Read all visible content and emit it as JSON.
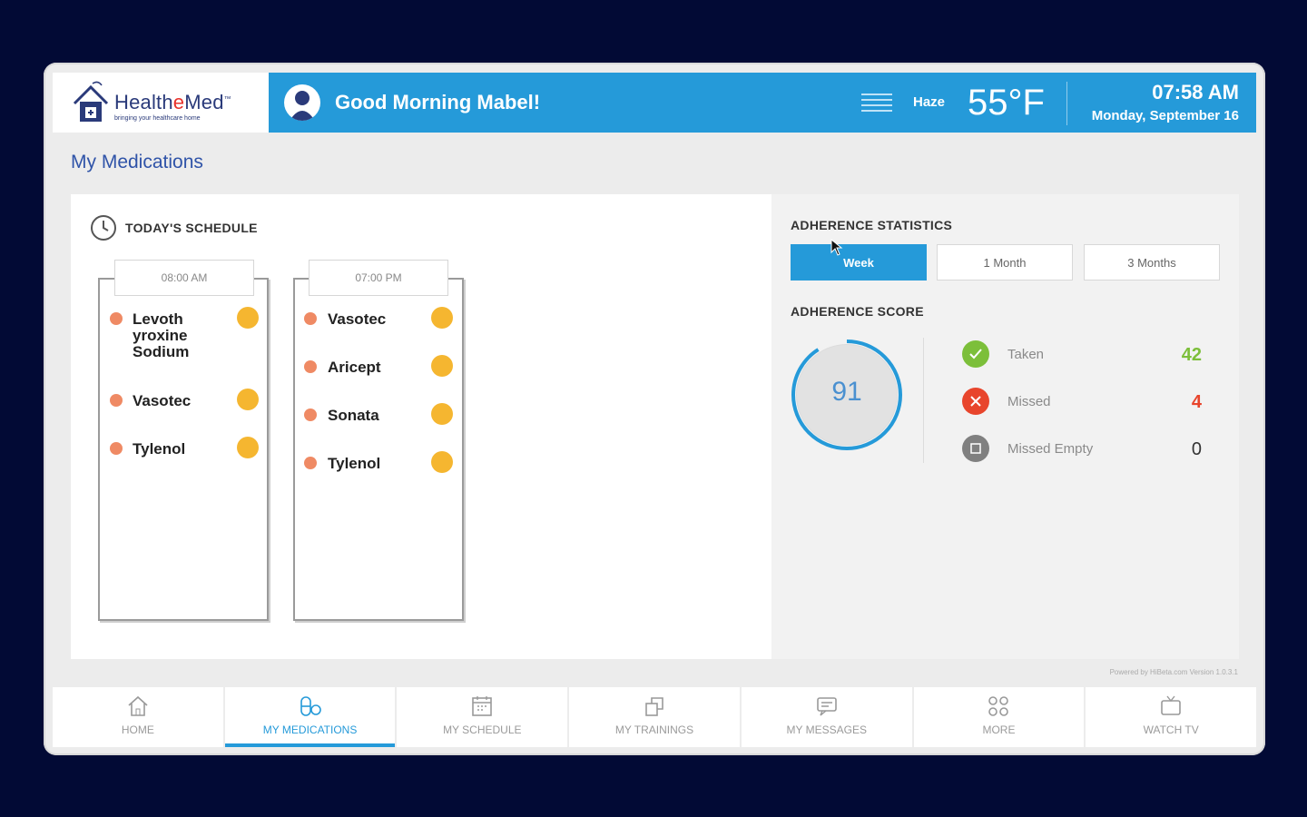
{
  "brand": {
    "name_prefix": "Health",
    "name_e": "e",
    "name_suffix": "Med",
    "tm": "™",
    "tagline": "bringing your healthcare home"
  },
  "header": {
    "greeting": "Good Morning Mabel!",
    "weather_condition": "Haze",
    "temperature": "55°F",
    "time": "07:58 AM",
    "date": "Monday, September 16"
  },
  "page_title": "My Medications",
  "schedule": {
    "title": "TODAY'S SCHEDULE",
    "slots": [
      {
        "time": "08:00 AM",
        "meds": [
          {
            "name": "Levoth yroxine Sodium"
          },
          {
            "name": "Vasotec"
          },
          {
            "name": "Tylenol"
          }
        ]
      },
      {
        "time": "07:00 PM",
        "meds": [
          {
            "name": "Vasotec"
          },
          {
            "name": "Aricept"
          },
          {
            "name": "Sonata"
          },
          {
            "name": "Tylenol"
          }
        ]
      }
    ]
  },
  "adherence": {
    "stats_title": "ADHERENCE STATISTICS",
    "tabs": [
      "Week",
      "1 Month",
      "3 Months"
    ],
    "active_tab": "Week",
    "score_title": "ADHERENCE SCORE",
    "score": "91",
    "stats": [
      {
        "label": "Taken",
        "value": "42",
        "color": "#7cbf3a",
        "icon": "check-icon"
      },
      {
        "label": "Missed",
        "value": "4",
        "color": "#e8452c",
        "icon": "close-icon"
      },
      {
        "label": "Missed Empty",
        "value": "0",
        "color": "#808080",
        "icon": "empty-box-icon"
      }
    ]
  },
  "footer_note": "Powered by HiBeta.com Version 1.0.3.1",
  "nav": [
    {
      "label": "HOME",
      "icon": "home-icon"
    },
    {
      "label": "MY MEDICATIONS",
      "icon": "pills-icon",
      "active": true
    },
    {
      "label": "MY SCHEDULE",
      "icon": "calendar-icon"
    },
    {
      "label": "MY TRAININGS",
      "icon": "training-icon"
    },
    {
      "label": "MY MESSAGES",
      "icon": "message-icon"
    },
    {
      "label": "MORE",
      "icon": "grid-icon"
    },
    {
      "label": "WATCH TV",
      "icon": "tv-icon"
    }
  ],
  "colors": {
    "accent": "#259ad9",
    "background": "#020a35",
    "dose_dot": "#ef8a64",
    "pending": "#f5b630"
  }
}
